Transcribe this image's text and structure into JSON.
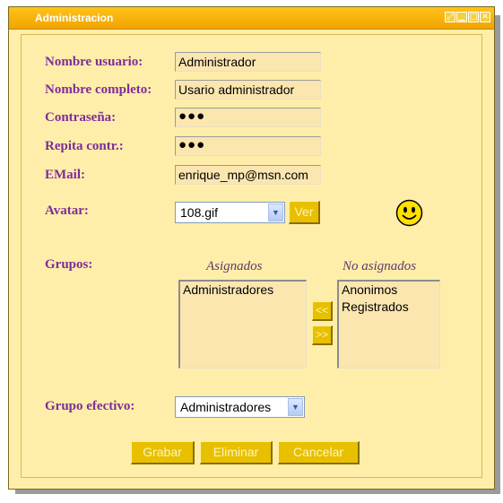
{
  "window": {
    "title": "Administracion",
    "buttons": [
      "restore",
      "minimize",
      "maximize",
      "close"
    ]
  },
  "form": {
    "username": {
      "label": "Nombre usuario:",
      "value": "Administrador"
    },
    "fullname": {
      "label": "Nombre completo:",
      "value": "Usario administrador"
    },
    "password": {
      "label": "Contraseña:",
      "value": "●●●"
    },
    "password_repeat": {
      "label": "Repita contr.:",
      "value": "●●●"
    },
    "email": {
      "label": "EMail:",
      "value": "enrique_mp@msn.com"
    },
    "avatar": {
      "label": "Avatar:",
      "selected": "108.gif",
      "view_button": "Ver",
      "preview_icon": "smiley-face-icon"
    },
    "groups": {
      "label": "Grupos:",
      "assigned_header": "Asignados",
      "unassigned_header": "No asignados",
      "assigned": [
        "Administradores"
      ],
      "unassigned": [
        "Anonimos",
        "Registrados"
      ],
      "add_button": "<<",
      "remove_button": ">>"
    },
    "effective_group": {
      "label": "Grupo efectivo:",
      "selected": "Administradores"
    }
  },
  "actions": {
    "save": "Grabar",
    "delete": "Eliminar",
    "cancel": "Cancelar"
  },
  "colors": {
    "titlebar": "#f2a400",
    "background": "#ffeeaa",
    "label": "#7e2d99",
    "button": "#e8c000"
  }
}
